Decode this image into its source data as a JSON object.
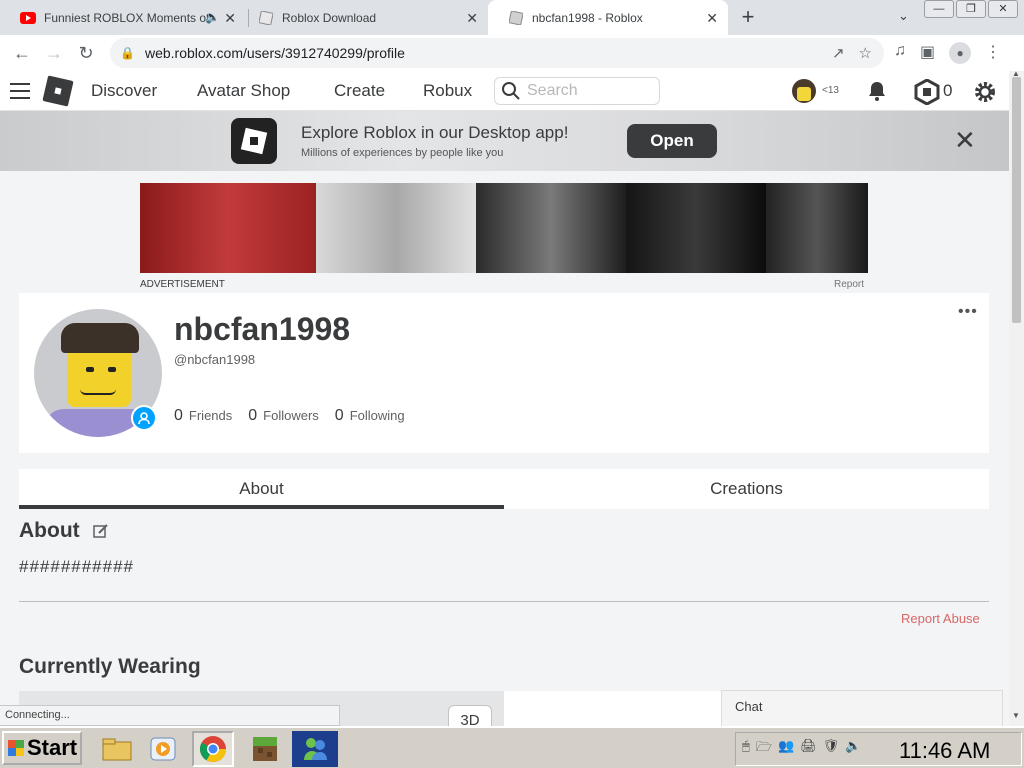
{
  "browser": {
    "tabs": [
      {
        "title": "Funniest ROBLOX Moments of",
        "favicon": "youtube-icon",
        "audio": true,
        "active": false
      },
      {
        "title": "Roblox Download",
        "favicon": "page-icon",
        "active": false
      },
      {
        "title": "nbcfan1998 - Roblox",
        "favicon": "roblox-icon",
        "active": true
      }
    ],
    "url": "web.roblox.com/users/3912740299/profile",
    "status_text": "Connecting..."
  },
  "nav": {
    "links": [
      "Discover",
      "Avatar Shop",
      "Create",
      "Robux"
    ],
    "search_placeholder": "Search",
    "age_label": "<13",
    "robux_count": "0"
  },
  "app_banner": {
    "title": "Explore Roblox in our Desktop app!",
    "subtitle": "Millions of experiences by people like you",
    "open_label": "Open"
  },
  "ad": {
    "label": "ADVERTISEMENT",
    "report_label": "Report"
  },
  "profile": {
    "display_name": "nbcfan1998",
    "handle": "@nbcfan1998",
    "friends_count": "0",
    "friends_label": "Friends",
    "followers_count": "0",
    "followers_label": "Followers",
    "following_count": "0",
    "following_label": "Following",
    "more_label": "•••"
  },
  "profile_tabs": {
    "about": "About",
    "creations": "Creations"
  },
  "about": {
    "heading": "About",
    "text": "###########",
    "report_abuse": "Report Abuse"
  },
  "wearing": {
    "heading": "Currently Wearing",
    "toggle_3d": "3D"
  },
  "chat": {
    "label": "Chat"
  },
  "taskbar": {
    "start_label": "Start",
    "clock": "11:46 AM"
  },
  "colors": {
    "roblox_dark": "#393b3d",
    "accent_blue": "#00a2ff",
    "report_red": "#d86868"
  }
}
